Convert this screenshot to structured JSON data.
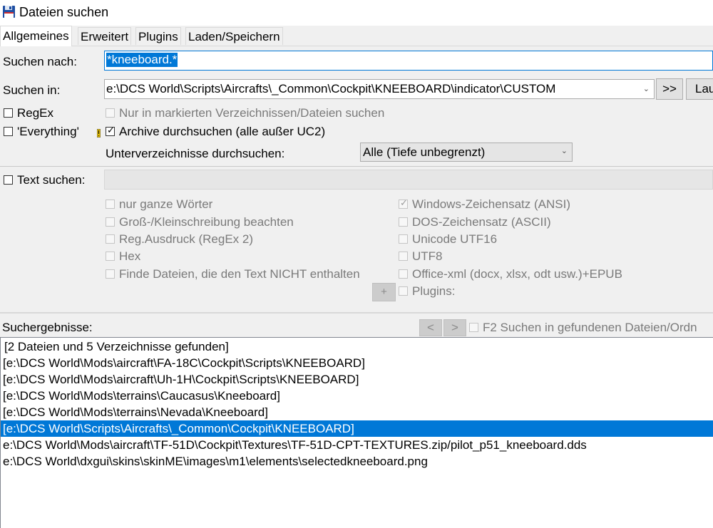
{
  "window": {
    "title": "Dateien suchen"
  },
  "tabs": [
    "Allgemeines",
    "Erweitert",
    "Plugins",
    "Laden/Speichern"
  ],
  "search": {
    "for_label": "Suchen nach:",
    "for_value": "*kneeboard.*",
    "in_label": "Suchen in:",
    "in_value": "e:\\DCS World\\Scripts\\Aircrafts\\_Common\\Cockpit\\KNEEBOARD\\indicator\\CUSTOM",
    "browse_button": ">>",
    "start_button": "Lau"
  },
  "options": {
    "regex": "RegEx",
    "only_marked": "Nur in markierten Verzeichnissen/Dateien suchen",
    "everything": "'Everything'",
    "archives": "Archive durchsuchen (alle außer UC2)",
    "archives_checked": true,
    "subdirs_label": "Unterverzeichnisse durchsuchen:",
    "subdirs_value": "Alle (Tiefe unbegrenzt)"
  },
  "text_search": {
    "label": "Text suchen:",
    "left_options": [
      "nur ganze Wörter",
      "Groß-/Kleinschreibung beachten",
      "Reg.Ausdruck (RegEx 2)",
      "Hex",
      "Finde Dateien, die den Text NICHT enthalten"
    ],
    "right_options": [
      {
        "label": "Windows-Zeichensatz (ANSI)",
        "checked": true
      },
      {
        "label": "DOS-Zeichensatz (ASCII)",
        "checked": false
      },
      {
        "label": "Unicode UTF16",
        "checked": false
      },
      {
        "label": "UTF8",
        "checked": false
      },
      {
        "label": "Office-xml (docx, xlsx, odt usw.)+EPUB",
        "checked": false
      }
    ],
    "plugins_button": "+",
    "plugins_label": "Plugins:"
  },
  "results": {
    "label": "Suchergebnisse:",
    "prev_button": "<",
    "next_button": ">",
    "f2_label": "F2 Suchen in gefundenen Dateien/Ordn",
    "rows": [
      " [2 Dateien und 5 Verzeichnisse gefunden]",
      "[e:\\DCS World\\Mods\\aircraft\\FA-18C\\Cockpit\\Scripts\\KNEEBOARD]",
      "[e:\\DCS World\\Mods\\aircraft\\Uh-1H\\Cockpit\\Scripts\\KNEEBOARD]",
      "[e:\\DCS World\\Mods\\terrains\\Caucasus\\Kneeboard]",
      "[e:\\DCS World\\Mods\\terrains\\Nevada\\Kneeboard]",
      "[e:\\DCS World\\Scripts\\Aircrafts\\_Common\\Cockpit\\KNEEBOARD]",
      "e:\\DCS World\\Mods\\aircraft\\TF-51D\\Cockpit\\Textures\\TF-51D-CPT-TEXTURES.zip/pilot_p51_kneeboard.dds",
      "e:\\DCS World\\dxgui\\skins\\skinME\\images\\m1\\elements\\selectedkneeboard.png"
    ],
    "selected_row": 5
  },
  "colors": {
    "selection": "#0078d7",
    "window": "#f0f0f0"
  }
}
